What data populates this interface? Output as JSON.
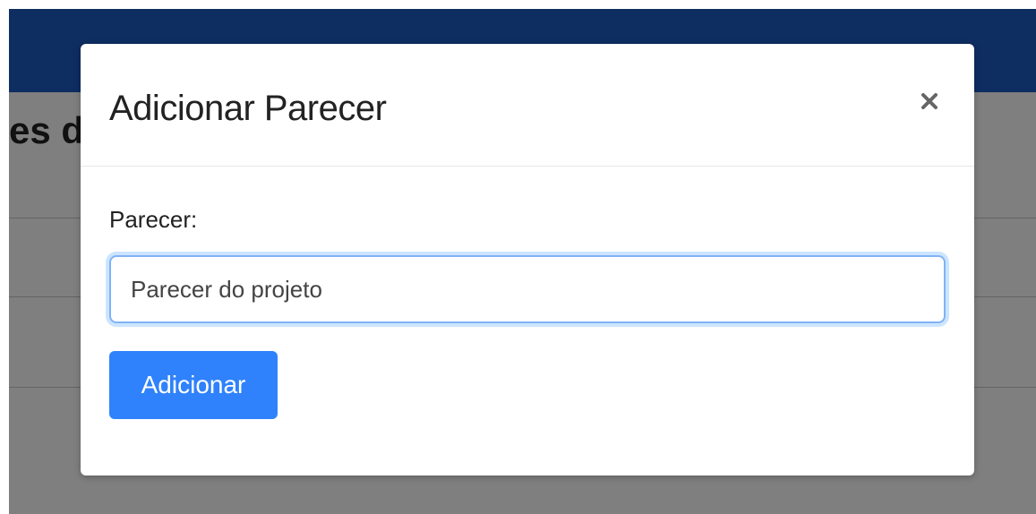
{
  "app": {
    "heading_fragment": "es d",
    "navbar_color": "#1c5bc2"
  },
  "modal": {
    "title": "Adicionar Parecer",
    "close_icon": "close-icon",
    "close_glyph": "×",
    "field_label": "Parecer:",
    "input_value": "Parecer do projeto",
    "submit_label": "Adicionar",
    "accent_color": "#2f82fb"
  }
}
